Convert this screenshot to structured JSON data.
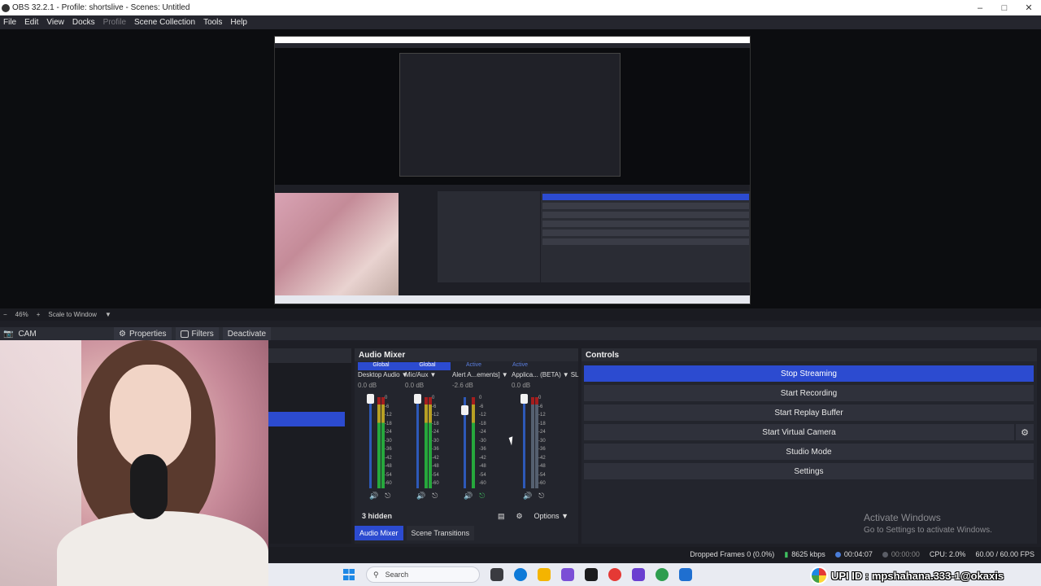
{
  "window": {
    "title": "OBS 32.2.1 - Profile: shortslive - Scenes: Untitled",
    "controls": [
      "–",
      "□",
      "✕"
    ]
  },
  "menu": [
    "File",
    "Edit",
    "View",
    "Docks",
    "Profile",
    "Scene Collection",
    "Tools",
    "Help"
  ],
  "menu_disabled": "Profile",
  "preview_status": {
    "zoom": "46%",
    "scale_mode": "Scale to Window"
  },
  "source_toolbar": {
    "source_name": "CAM",
    "properties": "Properties",
    "filters": "Filters",
    "deactivate": "Deactivate"
  },
  "audio_mixer": {
    "title": "Audio Mixer",
    "tabs": [
      "Global",
      "Global",
      "Active",
      "Active"
    ],
    "channels": [
      {
        "name": "Desktop Audio",
        "db": "0.0 dB",
        "level": 0.0
      },
      {
        "name": "Mic/Aux",
        "db": "0.0 dB",
        "level": 0.0
      },
      {
        "name": "Alert A...ements]",
        "db": "-2.6 dB",
        "level": -2.6
      },
      {
        "name": "Applica... (BETA)",
        "db": "0.0 dB",
        "level": 0.0
      }
    ],
    "overflow_label": "SL",
    "scale": [
      "0",
      "-6",
      "-12",
      "-18",
      "-24",
      "-30",
      "-36",
      "-42",
      "-48",
      "-54",
      "-60"
    ],
    "hidden_count": "3 hidden",
    "options": "Options"
  },
  "dock_tabs": {
    "audio_mixer": "Audio Mixer",
    "scene_transitions": "Scene Transitions"
  },
  "controls": {
    "title": "Controls",
    "stop_streaming": "Stop Streaming",
    "start_recording": "Start Recording",
    "start_replay_buffer": "Start Replay Buffer",
    "start_virtual_camera": "Start Virtual Camera",
    "studio_mode": "Studio Mode",
    "settings": "Settings"
  },
  "activate_windows": {
    "title": "Activate Windows",
    "subtitle": "Go to Settings to activate Windows."
  },
  "status_bar": {
    "dropped_frames": "Dropped Frames 0 (0.0%)",
    "bitrate": "8625 kbps",
    "stream_time": "00:04:07",
    "record_time": "00:00:00",
    "cpu": "CPU: 2.0%",
    "fps": "60.00 / 60.00 FPS"
  },
  "taskbar": {
    "search_placeholder": "Search"
  },
  "overlay_banner": {
    "text": "UPI ID : mpshahana.333-1@okaxis"
  },
  "colors": {
    "accent_blue": "#2c4bd0",
    "panel_bg": "#23252d",
    "window_bg": "#1e1f26"
  }
}
